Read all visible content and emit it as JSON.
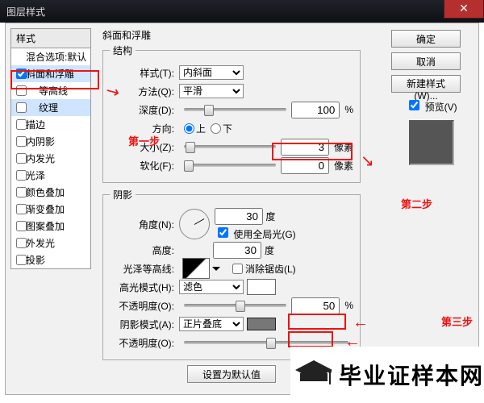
{
  "window": {
    "title": "图层样式",
    "close": "✕"
  },
  "sidebar": {
    "header": "样式",
    "subheader": "混合选项:默认",
    "items": [
      {
        "label": "斜面和浮雕",
        "checked": true,
        "sel": true
      },
      {
        "label": "等高线",
        "checked": false,
        "sub": true
      },
      {
        "label": "纹理",
        "checked": false,
        "sub": true,
        "sel": true
      },
      {
        "label": "描边",
        "checked": false
      },
      {
        "label": "内阴影",
        "checked": false
      },
      {
        "label": "内发光",
        "checked": false
      },
      {
        "label": "光泽",
        "checked": false
      },
      {
        "label": "颜色叠加",
        "checked": false
      },
      {
        "label": "渐变叠加",
        "checked": false
      },
      {
        "label": "图案叠加",
        "checked": false
      },
      {
        "label": "外发光",
        "checked": false
      },
      {
        "label": "投影",
        "checked": false
      }
    ]
  },
  "panel": {
    "title": "斜面和浮雕",
    "structure": {
      "legend": "结构",
      "styleLabel": "样式(T):",
      "styleValue": "内斜面",
      "methodLabel": "方法(Q):",
      "methodValue": "平滑",
      "depthLabel": "深度(D):",
      "depthValue": "100",
      "depthUnit": "%",
      "dirLabel": "方向:",
      "dirUp": "上",
      "dirDown": "下",
      "sizeLabel": "大小(Z):",
      "sizeValue": "3",
      "sizeUnit": "像素",
      "softenLabel": "软化(F):",
      "softenValue": "0",
      "softenUnit": "像素"
    },
    "shadow": {
      "legend": "阴影",
      "angleLabel": "角度(N):",
      "angleValue": "30",
      "angleUnit": "度",
      "globalLabel": "使用全局光(G)",
      "altLabel": "高度:",
      "altValue": "30",
      "altUnit": "度",
      "glossLabel": "光泽等高线:",
      "aaLabel": "消除锯齿(L)",
      "hiLabel": "高光模式(H):",
      "hiValue": "滤色",
      "hiOpLabel": "不透明度(O):",
      "hiOpValue": "50",
      "hiOpUnit": "%",
      "shLabel": "阴影模式(A):",
      "shValue": "正片叠底",
      "shOpLabel": "不透明度(O):"
    },
    "defaults": "设置为默认值"
  },
  "buttons": {
    "ok": "确定",
    "cancel": "取消",
    "newstyle": "新建样式(W)...",
    "preview": "预览(V)"
  },
  "annotations": {
    "step1": "第一步",
    "step2": "第二步",
    "step3": "第三步"
  },
  "logo": {
    "text": "毕业证样本网"
  }
}
